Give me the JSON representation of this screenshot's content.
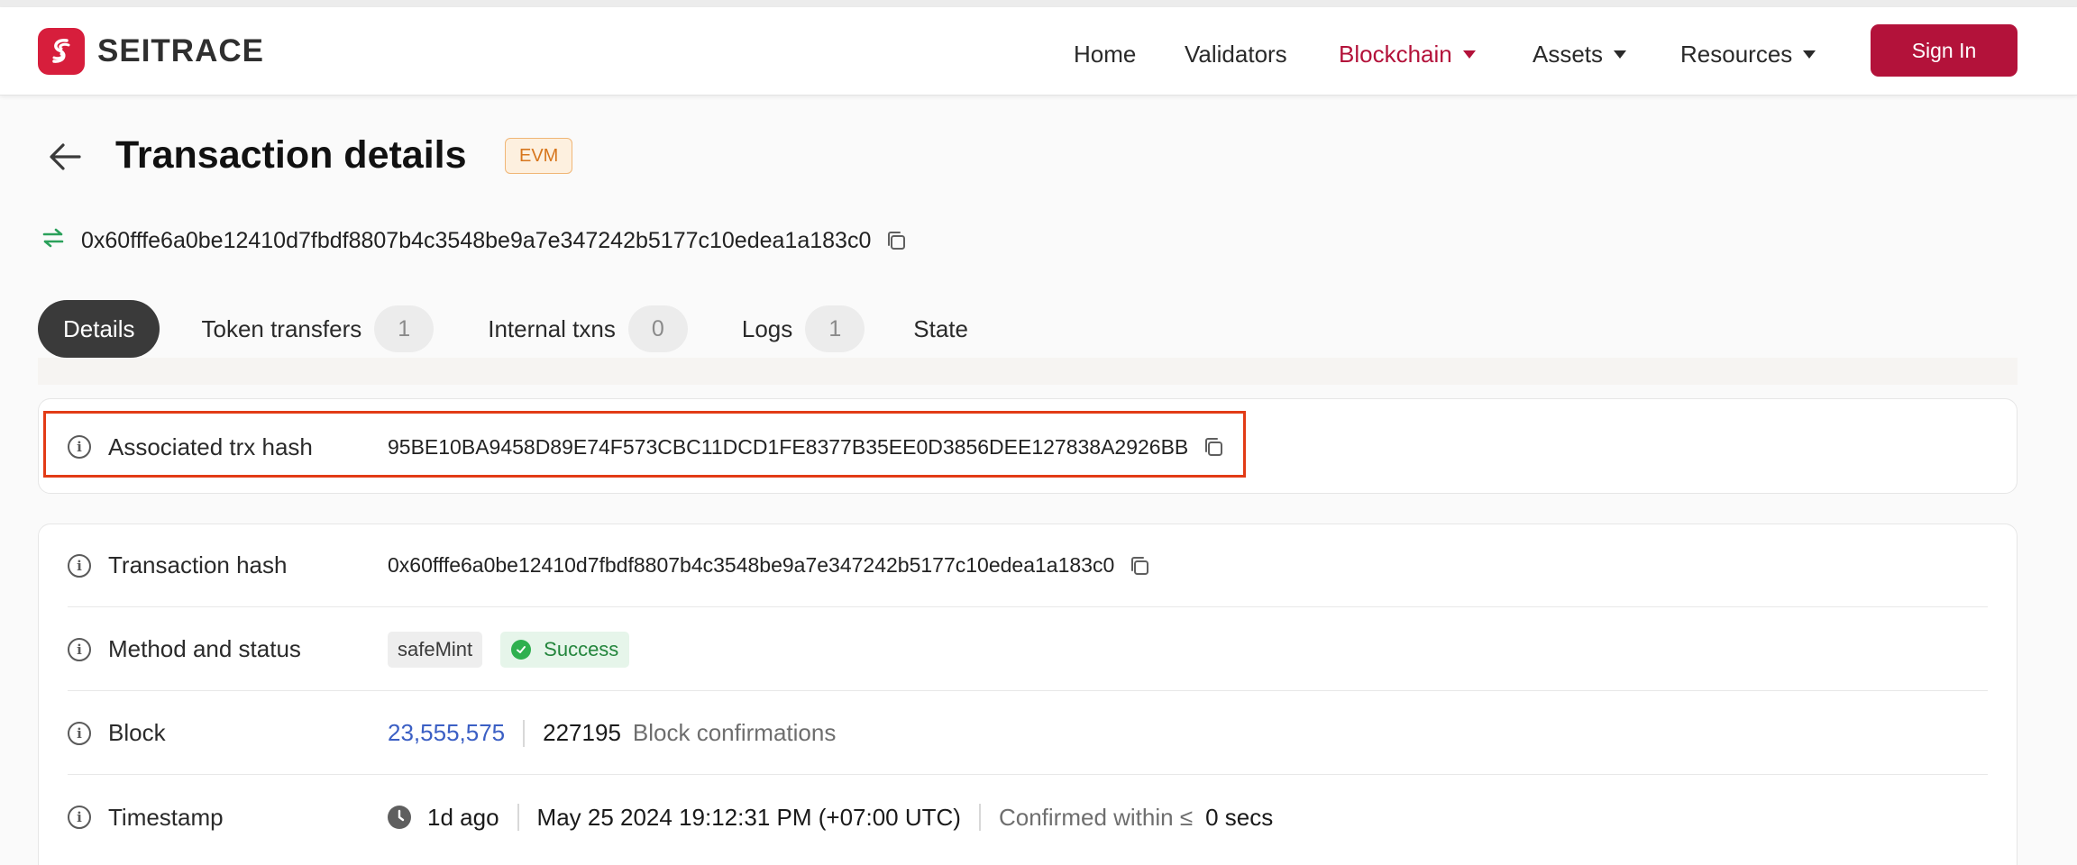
{
  "brand": {
    "name": "SEITRACE",
    "color": "#d71e3c"
  },
  "nav": {
    "items": [
      {
        "label": "Home"
      },
      {
        "label": "Validators"
      },
      {
        "label": "Blockchain"
      },
      {
        "label": "Assets"
      },
      {
        "label": "Resources"
      }
    ],
    "active": "Blockchain",
    "sign_in": "Sign In"
  },
  "page": {
    "title": "Transaction details",
    "badge": "EVM",
    "tx_hash": "0x60fffe6a0be12410d7fbdf8807b4c3548be9a7e347242b5177c10edea1a183c0"
  },
  "tabs": [
    {
      "label": "Details"
    },
    {
      "label": "Token transfers",
      "count": "1"
    },
    {
      "label": "Internal txns",
      "count": "0"
    },
    {
      "label": "Logs",
      "count": "1"
    },
    {
      "label": "State"
    }
  ],
  "associated": {
    "label": "Associated trx hash",
    "value": "95BE10BA9458D89E74F573CBC11DCD1FE8377B35EE0D3856DEE127838A2926BB"
  },
  "details": {
    "tx_hash": {
      "label": "Transaction hash",
      "value": "0x60fffe6a0be12410d7fbdf8807b4c3548be9a7e347242b5177c10edea1a183c0"
    },
    "method": {
      "label": "Method and status",
      "method": "safeMint",
      "status": "Success"
    },
    "block": {
      "label": "Block",
      "number": "23,555,575",
      "confirmations": "227195",
      "confirmations_label": "Block confirmations"
    },
    "timestamp": {
      "label": "Timestamp",
      "ago": "1d ago",
      "datetime": "May 25 2024 19:12:31 PM (+07:00 UTC)",
      "confirmed_label": "Confirmed within ≤",
      "confirmed_value": "0 secs"
    }
  },
  "colors": {
    "accent": "#b3123a",
    "link": "#3b5fc4",
    "success": "#23853c",
    "highlight": "#e23b16"
  }
}
